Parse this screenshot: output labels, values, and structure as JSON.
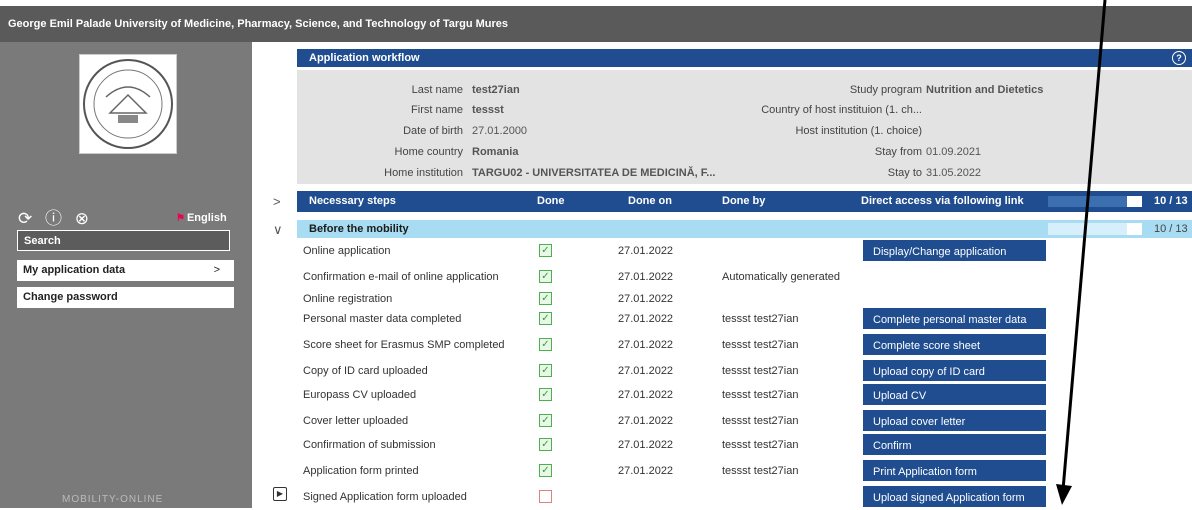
{
  "header": {
    "title": "George Emil Palade University of Medicine, Pharmacy, Science, and Technology of Targu Mures"
  },
  "sidebar": {
    "icons": [
      "refresh-icon",
      "help-icon",
      "close-icon"
    ],
    "language": "English",
    "search_label": "Search",
    "items": [
      {
        "label": "My application data"
      },
      {
        "label": "Change password"
      }
    ],
    "footer_logo": "MOBILITY-ONLINE"
  },
  "workflow": {
    "title": "Application workflow",
    "info": {
      "last_name_label": "Last name",
      "last_name": "test27ian",
      "first_name_label": "First name",
      "first_name": "tessst",
      "dob_label": "Date of birth",
      "dob": "27.01.2000",
      "home_country_label": "Home country",
      "home_country": "Romania",
      "home_institution_label": "Home institution",
      "home_institution": "TARGU02 - UNIVERSITATEA DE MEDICINĂ, F...",
      "study_program_label": "Study program",
      "study_program": "Nutrition and Dietetics",
      "country_host_label": "Country of host instituion (1. ch...",
      "host_inst_label": "Host institution (1. choice)",
      "stay_from_label": "Stay from",
      "stay_from": "01.09.2021",
      "stay_to_label": "Stay to",
      "stay_to": "31.05.2022"
    },
    "steps_header": {
      "col_steps": "Necessary steps",
      "col_done": "Done",
      "col_done_on": "Done on",
      "col_done_by": "Done by",
      "col_link": "Direct access via following link",
      "progress": "10 / 13",
      "progress_fraction": 0.77
    },
    "before": {
      "label": "Before the mobility",
      "progress": "10 / 13",
      "progress_fraction": 0.77
    },
    "rows": [
      {
        "name": "Online application",
        "done": true,
        "date": "27.01.2022",
        "by": "",
        "button": "Display/Change application"
      },
      {
        "name": "Confirmation e-mail of online application",
        "done": true,
        "date": "27.01.2022",
        "by": "Automatically generated",
        "button": ""
      },
      {
        "name": "Online registration",
        "done": true,
        "date": "27.01.2022",
        "by": "",
        "button": ""
      },
      {
        "name": "Personal master data completed",
        "done": true,
        "date": "27.01.2022",
        "by": "tessst test27ian",
        "button": "Complete personal master data"
      },
      {
        "name": "Score sheet for Erasmus SMP completed",
        "done": true,
        "date": "27.01.2022",
        "by": "tessst test27ian",
        "button": "Complete score sheet"
      },
      {
        "name": "Copy of ID card uploaded",
        "done": true,
        "date": "27.01.2022",
        "by": "tessst test27ian",
        "button": "Upload copy of ID card"
      },
      {
        "name": "Europass CV uploaded",
        "done": true,
        "date": "27.01.2022",
        "by": "tessst test27ian",
        "button": "Upload CV"
      },
      {
        "name": "Cover letter uploaded",
        "done": true,
        "date": "27.01.2022",
        "by": "tessst test27ian",
        "button": "Upload cover letter"
      },
      {
        "name": "Confirmation of submission",
        "done": true,
        "date": "27.01.2022",
        "by": "tessst test27ian",
        "button": "Confirm"
      },
      {
        "name": "Application form printed",
        "done": true,
        "date": "27.01.2022",
        "by": "tessst test27ian",
        "button": "Print Application form"
      },
      {
        "name": "Signed Application form uploaded",
        "done": false,
        "date": "",
        "by": "",
        "button": "Upload signed Application form"
      }
    ]
  }
}
